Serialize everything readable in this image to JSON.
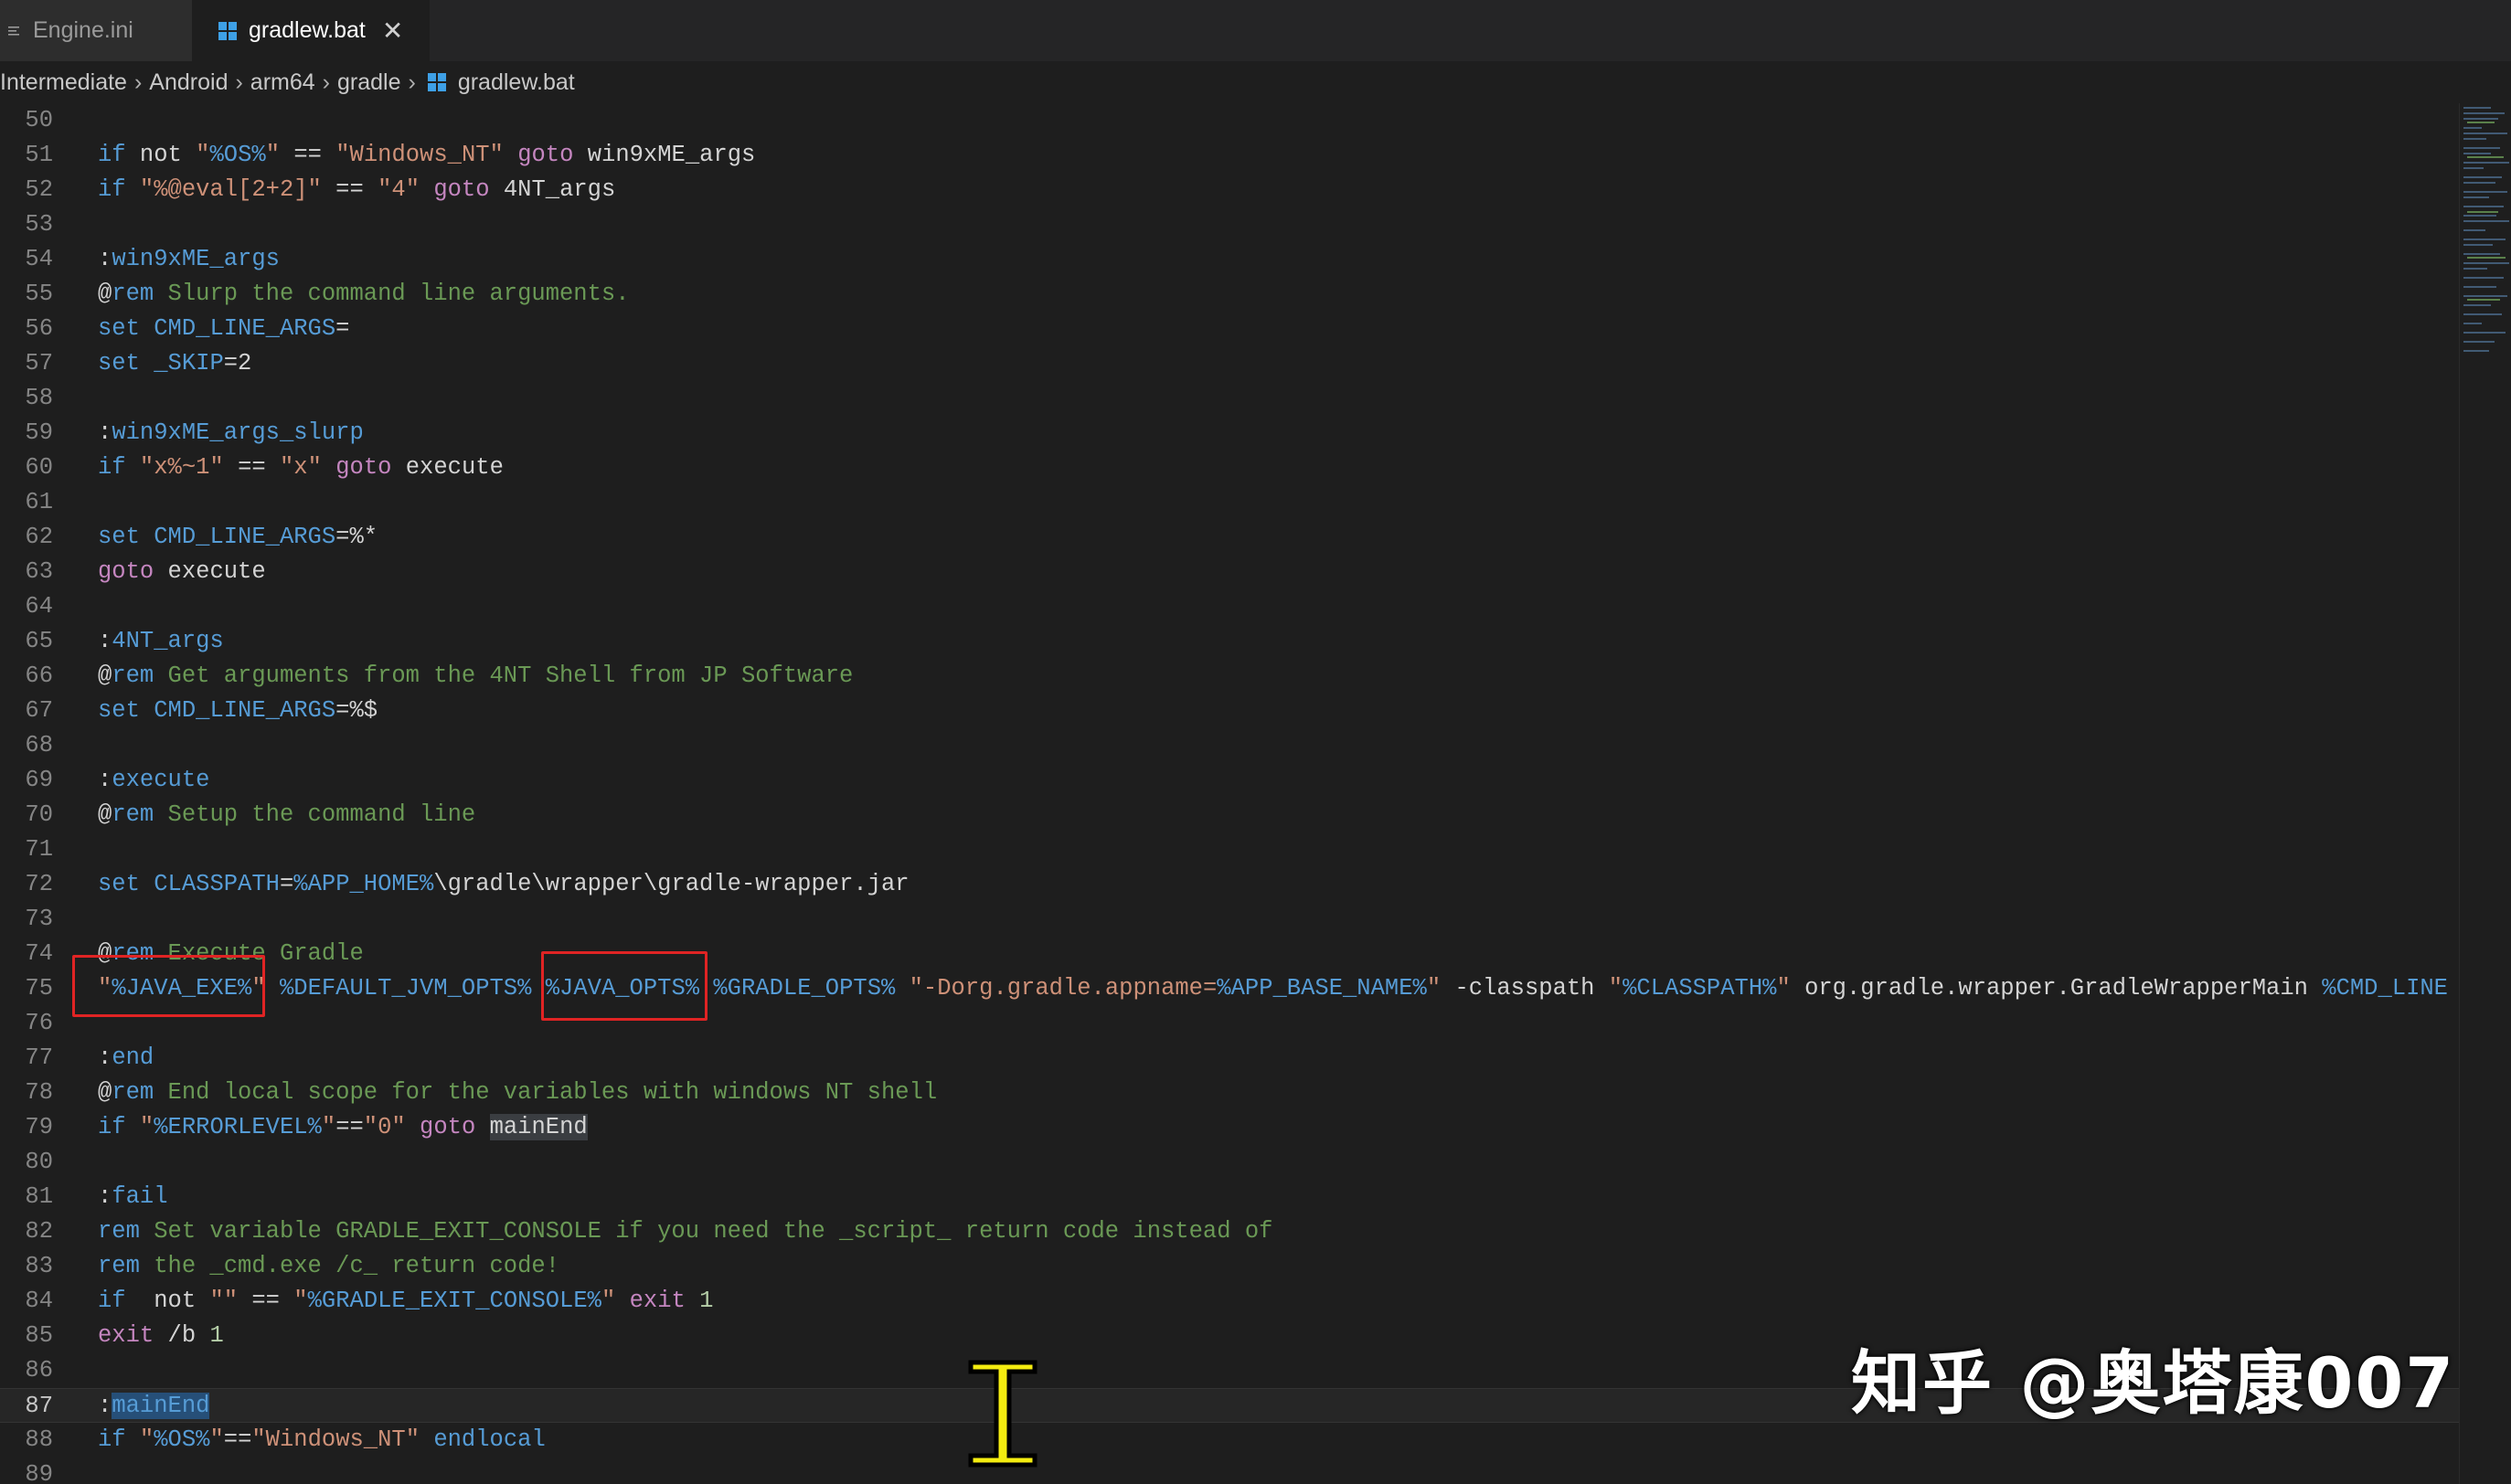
{
  "tabs": [
    {
      "label": "Engine.ini",
      "icon": "lines-icon",
      "active": false
    },
    {
      "label": "gradlew.bat",
      "icon": "windows-icon",
      "active": true,
      "close": "✕"
    }
  ],
  "breadcrumb": [
    "Intermediate",
    "Android",
    "arm64",
    "gradle",
    "gradlew.bat"
  ],
  "breadcrumb_separator": "›",
  "colors": {
    "keyword": "#569cd6",
    "string": "#ce9178",
    "comment": "#6a9955",
    "control": "#c586c0",
    "highlight_box": "#e02424"
  },
  "editor": {
    "current_line": 87,
    "lines": [
      {
        "n": "50",
        "t": ""
      },
      {
        "n": "51",
        "t": "if not \"%OS%\" == \"Windows_NT\" goto win9xME_args"
      },
      {
        "n": "52",
        "t": "if \"%@eval[2+2]\" == \"4\" goto 4NT_args"
      },
      {
        "n": "53",
        "t": ""
      },
      {
        "n": "54",
        "t": ":win9xME_args"
      },
      {
        "n": "55",
        "t": "@rem Slurp the command line arguments."
      },
      {
        "n": "56",
        "t": "set CMD_LINE_ARGS="
      },
      {
        "n": "57",
        "t": "set _SKIP=2"
      },
      {
        "n": "58",
        "t": ""
      },
      {
        "n": "59",
        "t": ":win9xME_args_slurp"
      },
      {
        "n": "60",
        "t": "if \"x%~1\" == \"x\" goto execute"
      },
      {
        "n": "61",
        "t": ""
      },
      {
        "n": "62",
        "t": "set CMD_LINE_ARGS=%*"
      },
      {
        "n": "63",
        "t": "goto execute"
      },
      {
        "n": "64",
        "t": ""
      },
      {
        "n": "65",
        "t": ":4NT_args"
      },
      {
        "n": "66",
        "t": "@rem Get arguments from the 4NT Shell from JP Software"
      },
      {
        "n": "67",
        "t": "set CMD_LINE_ARGS=%$"
      },
      {
        "n": "68",
        "t": ""
      },
      {
        "n": "69",
        "t": ":execute"
      },
      {
        "n": "70",
        "t": "@rem Setup the command line"
      },
      {
        "n": "71",
        "t": ""
      },
      {
        "n": "72",
        "t": "set CLASSPATH=%APP_HOME%\\gradle\\wrapper\\gradle-wrapper.jar"
      },
      {
        "n": "73",
        "t": ""
      },
      {
        "n": "74",
        "t": "@rem Execute Gradle"
      },
      {
        "n": "75",
        "t": "\"%JAVA_EXE%\" %DEFAULT_JVM_OPTS% %JAVA_OPTS% %GRADLE_OPTS% \"-Dorg.gradle.appname=%APP_BASE_NAME%\" -classpath \"%CLASSPATH%\" org.gradle.wrapper.GradleWrapperMain %CMD_LINE"
      },
      {
        "n": "76",
        "t": ""
      },
      {
        "n": "77",
        "t": ":end"
      },
      {
        "n": "78",
        "t": "@rem End local scope for the variables with windows NT shell"
      },
      {
        "n": "79",
        "t": "if \"%ERRORLEVEL%\"==\"0\" goto mainEnd"
      },
      {
        "n": "80",
        "t": ""
      },
      {
        "n": "81",
        "t": ":fail"
      },
      {
        "n": "82",
        "t": "rem Set variable GRADLE_EXIT_CONSOLE if you need the _script_ return code instead of"
      },
      {
        "n": "83",
        "t": "rem the _cmd.exe /c_ return code!"
      },
      {
        "n": "84",
        "t": "if  not \"\" == \"%GRADLE_EXIT_CONSOLE%\" exit 1"
      },
      {
        "n": "85",
        "t": "exit /b 1"
      },
      {
        "n": "86",
        "t": ""
      },
      {
        "n": "87",
        "t": ":mainEnd"
      },
      {
        "n": "88",
        "t": "if \"%OS%\"==\"Windows_NT\" endlocal"
      },
      {
        "n": "89",
        "t": ""
      }
    ]
  },
  "watermark": "知乎 @奥塔康007"
}
